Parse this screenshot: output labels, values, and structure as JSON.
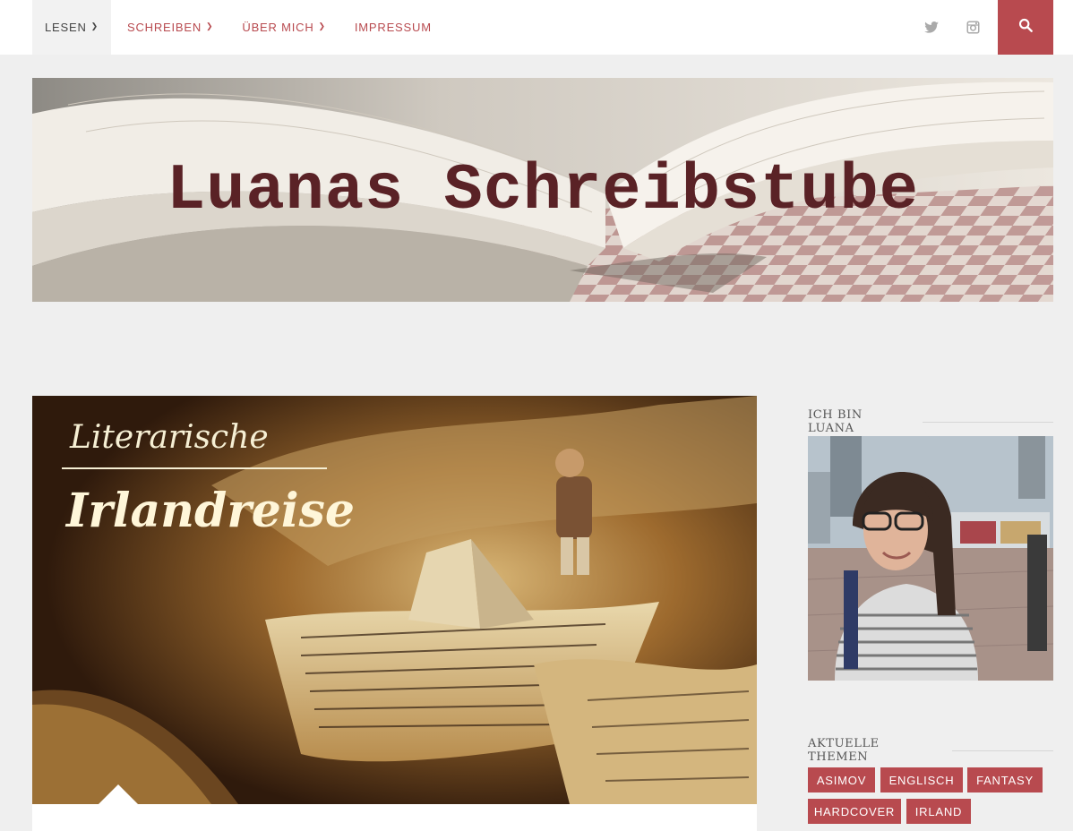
{
  "nav": {
    "items": [
      {
        "label": "LESEN",
        "has_dropdown": true,
        "active": true
      },
      {
        "label": "SCHREIBEN",
        "has_dropdown": true,
        "active": false
      },
      {
        "label": "ÜBER MICH",
        "has_dropdown": true,
        "active": false
      },
      {
        "label": "IMPRESSUM",
        "has_dropdown": false,
        "active": false
      }
    ],
    "social_icons": [
      "twitter-icon",
      "instagram-icon"
    ],
    "search_icon": "search-icon"
  },
  "header": {
    "title": "Luanas Schreibstube"
  },
  "featured_post": {
    "image_title_line1": "Literarische",
    "image_title_line2": "Irlandreise"
  },
  "sidebar": {
    "about_title": "ICH BIN LUANA",
    "topics_title": "AKTUELLE THEMEN",
    "tags": [
      "ASIMOV",
      "ENGLISCH",
      "FANTASY",
      "HARDCOVER",
      "IRLAND"
    ]
  },
  "colors": {
    "accent": "#b84a4f",
    "background": "#efefef",
    "title": "#5a2226"
  }
}
